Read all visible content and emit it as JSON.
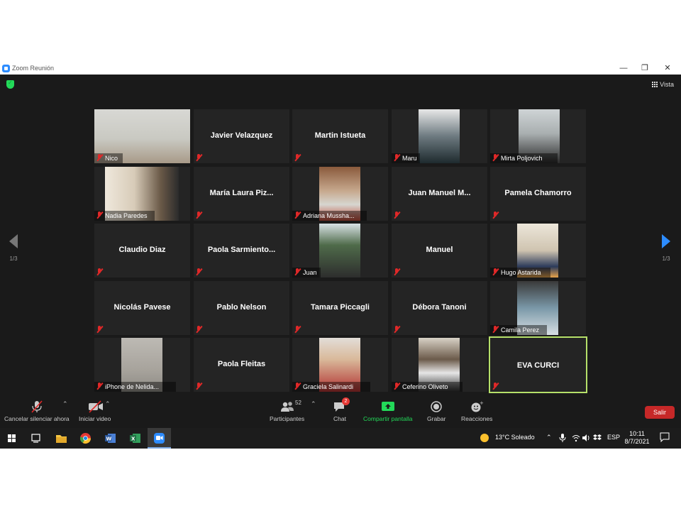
{
  "window": {
    "title": "Zoom Reunión",
    "minimize": "—",
    "restore": "❐",
    "close": "✕"
  },
  "header": {
    "view_label": "Vista"
  },
  "pager": {
    "left_text": "1/3",
    "right_text": "1/3"
  },
  "tiles": [
    {
      "name": "Nico",
      "video": true
    },
    {
      "name": "Javier Velazquez",
      "video": false
    },
    {
      "name": "Martin Istueta",
      "video": false
    },
    {
      "name": "Maru",
      "video": true
    },
    {
      "name": "Mirta Poljovich",
      "video": true
    },
    {
      "name": "Nadia Paredes",
      "video": true
    },
    {
      "name": "María  Laura  Piz...",
      "video": false
    },
    {
      "name": "Adriana Mussha...",
      "video": true
    },
    {
      "name": "Juan  Manuel  M...",
      "video": false
    },
    {
      "name": "Pamela Chamorro",
      "video": false
    },
    {
      "name": "Claudio Diaz",
      "video": false
    },
    {
      "name": "Paola  Sarmiento...",
      "video": false
    },
    {
      "name": "Juan",
      "video": true
    },
    {
      "name": "Manuel",
      "video": false
    },
    {
      "name": "Hugo Astarida",
      "video": true
    },
    {
      "name": "Nicolás Pavese",
      "video": false
    },
    {
      "name": "Pablo Nelson",
      "video": false
    },
    {
      "name": "Tamara Piccagli",
      "video": false
    },
    {
      "name": "Débora Tanoni",
      "video": false
    },
    {
      "name": "Camila Perez",
      "video": true
    },
    {
      "name": "iPhone de Nelida...",
      "video": true
    },
    {
      "name": "Paola Fleitas",
      "video": false
    },
    {
      "name": "Graciela Salinardi",
      "video": true
    },
    {
      "name": "Ceferino Oliveto",
      "video": true
    },
    {
      "name": "EVA CURCI",
      "video": false,
      "active": true
    }
  ],
  "toolbar": {
    "unmute_label": "Cancelar silenciar ahora",
    "video_label": "Iniciar video",
    "participants_label": "Participantes",
    "participants_count": "52",
    "chat_label": "Chat",
    "chat_badge": "2",
    "share_label": "Compartir pantalla",
    "record_label": "Grabar",
    "reactions_label": "Reacciones",
    "leave_label": "Salir"
  },
  "taskbar": {
    "weather": "13°C  Soleado",
    "language": "ESP",
    "time": "10:11",
    "date": "8/7/2021"
  },
  "colors": {
    "accent": "#2d8cff",
    "share_green": "#23d959",
    "leave_red": "#c62828",
    "active_border": "#b6e06a",
    "muted_red": "#e02828"
  }
}
